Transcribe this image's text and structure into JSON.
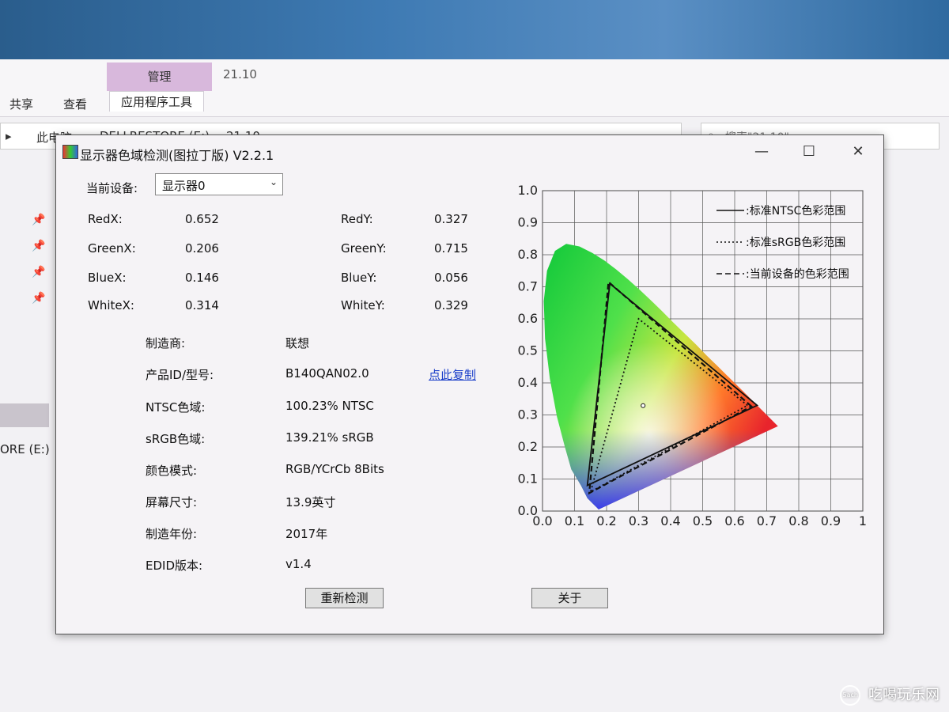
{
  "explorer": {
    "ribbon": {
      "context_tab": "管理",
      "folder_name": "21.10",
      "tabs": [
        "共享",
        "查看",
        "应用程序工具"
      ]
    },
    "address": {
      "parts": [
        "此电脑",
        "DELLRESTORE (E:)",
        "21.10"
      ]
    },
    "search_placeholder": "搜索\"21.10\"",
    "drive_label": "ORE (E:)"
  },
  "dialog": {
    "title": "显示器色域检测(图拉丁版) V2.2.1",
    "window_controls": {
      "minimize": "—",
      "maximize": "☐",
      "close": "✕"
    },
    "device_label": "当前设备:",
    "device_value": "显示器0",
    "coords": [
      {
        "label": "RedX:",
        "value": "0.652",
        "label2": "RedY:",
        "value2": "0.327"
      },
      {
        "label": "GreenX:",
        "value": "0.206",
        "label2": "GreenY:",
        "value2": "0.715"
      },
      {
        "label": "BlueX:",
        "value": "0.146",
        "label2": "BlueY:",
        "value2": "0.056"
      },
      {
        "label": "WhiteX:",
        "value": "0.314",
        "label2": "WhiteY:",
        "value2": "0.329"
      }
    ],
    "info": [
      {
        "label": "制造商:",
        "value": "联想"
      },
      {
        "label": "产品ID/型号:",
        "value": "B140QAN02.0"
      },
      {
        "label": "NTSC色域:",
        "value": "100.23% NTSC"
      },
      {
        "label": "sRGB色域:",
        "value": "139.21% sRGB"
      },
      {
        "label": "颜色模式:",
        "value": "RGB/YCrCb 8Bits"
      },
      {
        "label": "屏幕尺寸:",
        "value": "13.9英寸"
      },
      {
        "label": "制造年份:",
        "value": "2017年"
      },
      {
        "label": "EDID版本:",
        "value": "v1.4"
      }
    ],
    "copy_link": "点此复制",
    "buttons": {
      "redetect": "重新检测",
      "about": "关于"
    }
  },
  "chart_data": {
    "type": "scatter",
    "title": "",
    "xlim": [
      0,
      1
    ],
    "ylim": [
      0,
      1
    ],
    "x_ticks": [
      "0.0",
      "0.1",
      "0.2",
      "0.3",
      "0.4",
      "0.5",
      "0.6",
      "0.7",
      "0.8",
      "0.9",
      "1"
    ],
    "y_ticks": [
      "0.0",
      "0.1",
      "0.2",
      "0.3",
      "0.4",
      "0.5",
      "0.6",
      "0.7",
      "0.8",
      "0.9",
      "1.0"
    ],
    "grid": true,
    "legend_position": "top-right",
    "series": [
      {
        "name": "标准NTSC色彩范围",
        "style": "solid",
        "points": [
          [
            0.67,
            0.33
          ],
          [
            0.21,
            0.71
          ],
          [
            0.14,
            0.08
          ]
        ]
      },
      {
        "name": "标准sRGB色彩范围",
        "style": "dotted",
        "points": [
          [
            0.64,
            0.33
          ],
          [
            0.3,
            0.6
          ],
          [
            0.15,
            0.06
          ]
        ]
      },
      {
        "name": "当前设备的色彩范围",
        "style": "dashed",
        "points": [
          [
            0.652,
            0.327
          ],
          [
            0.206,
            0.715
          ],
          [
            0.146,
            0.056
          ]
        ]
      }
    ],
    "white_point": [
      0.314,
      0.329
    ]
  },
  "watermark": {
    "logo": "5ach",
    "text": "吃喝玩乐网"
  }
}
